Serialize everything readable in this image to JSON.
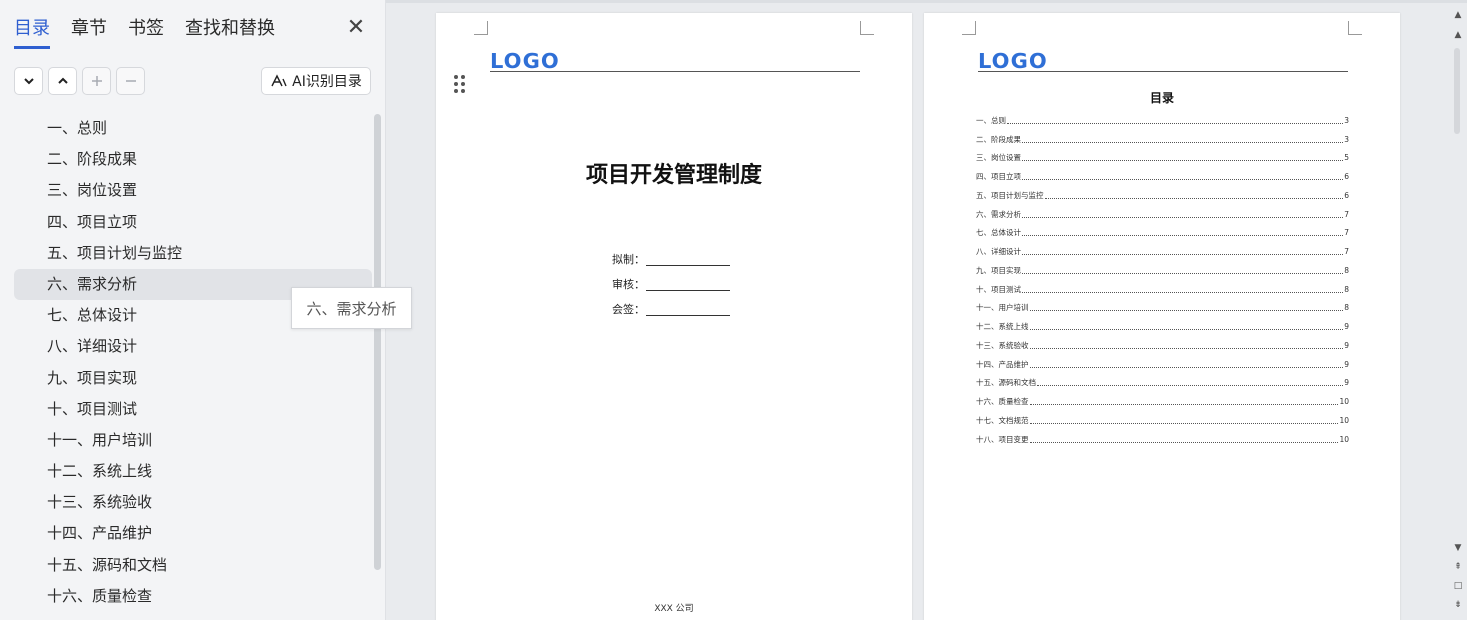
{
  "sidebar": {
    "tabs": [
      "目录",
      "章节",
      "书签",
      "查找和替换"
    ],
    "active_tab": 0,
    "close_icon": "close-icon",
    "ai_button_label": "AI识别目录",
    "outline_items": [
      "一、总则",
      "二、阶段成果",
      "三、岗位设置",
      "四、项目立项",
      "五、项目计划与监控",
      "六、需求分析",
      "七、总体设计",
      "八、详细设计",
      "九、项目实现",
      "十、项目测试",
      "十一、用户培训",
      "十二、系统上线",
      "十三、系统验收",
      "十四、产品维护",
      "十五、源码和文档",
      "十六、质量检查"
    ],
    "hovered_index": 5,
    "tooltip_text": "六、需求分析"
  },
  "page1": {
    "logo": "LOGO",
    "title": "项目开发管理制度",
    "sign_fields": [
      "拟制：",
      "审核：",
      "会签："
    ],
    "company": "XXX 公司"
  },
  "page2": {
    "logo": "LOGO",
    "toc_title": "目录",
    "toc": [
      {
        "title": "一、总则",
        "page": "3"
      },
      {
        "title": "二、阶段成果",
        "page": "3"
      },
      {
        "title": "三、岗位设置",
        "page": "5"
      },
      {
        "title": "四、项目立项",
        "page": "6"
      },
      {
        "title": "五、项目计划与监控",
        "page": "6"
      },
      {
        "title": "六、需求分析",
        "page": "7"
      },
      {
        "title": "七、总体设计",
        "page": "7"
      },
      {
        "title": "八、详细设计",
        "page": "7"
      },
      {
        "title": "九、项目实现",
        "page": "8"
      },
      {
        "title": "十、项目测试",
        "page": "8"
      },
      {
        "title": "十一、用户培训",
        "page": "8"
      },
      {
        "title": "十二、系统上线",
        "page": "9"
      },
      {
        "title": "十三、系统验收",
        "page": "9"
      },
      {
        "title": "十四、产品维护",
        "page": "9"
      },
      {
        "title": "十五、源码和文档",
        "page": "9"
      },
      {
        "title": "十六、质量检查",
        "page": "10"
      },
      {
        "title": "十七、文档规范",
        "page": "10"
      },
      {
        "title": "十八、项目变更",
        "page": "10"
      }
    ]
  },
  "colors": {
    "accent": "#2f5fd0",
    "logo": "#2f6fd6"
  }
}
